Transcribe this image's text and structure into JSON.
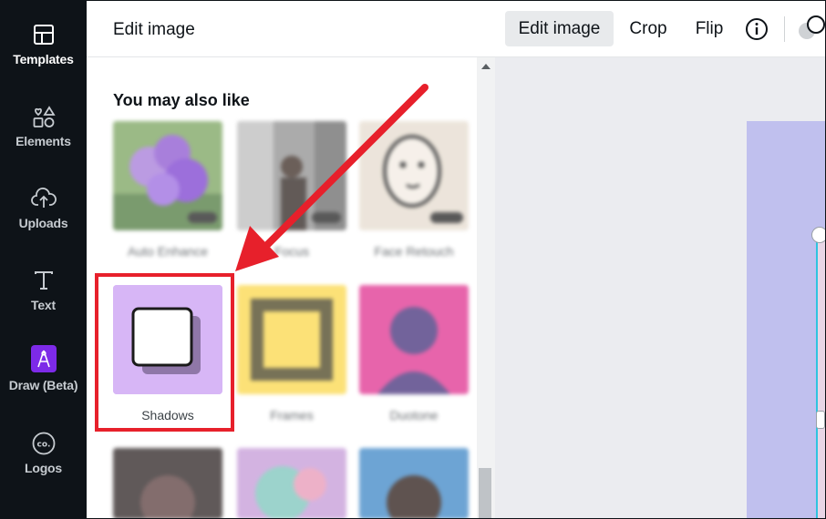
{
  "rail": {
    "items": [
      {
        "label": "Templates",
        "icon": "templates-icon",
        "active": true
      },
      {
        "label": "Elements",
        "icon": "elements-icon"
      },
      {
        "label": "Uploads",
        "icon": "uploads-icon"
      },
      {
        "label": "Text",
        "icon": "text-icon"
      },
      {
        "label": "Draw (Beta)",
        "icon": "draw-icon"
      },
      {
        "label": "Logos",
        "icon": "logos-icon"
      }
    ]
  },
  "panel": {
    "title": "Edit image",
    "section_title": "You may also like",
    "effects": [
      {
        "label": "Auto Enhance",
        "badge": "BETA"
      },
      {
        "label": "Focus",
        "badge": "BETA"
      },
      {
        "label": "Face Retouch",
        "badge": "BETA"
      },
      {
        "label": "Shadows"
      },
      {
        "label": "Frames"
      },
      {
        "label": "Duotone"
      }
    ]
  },
  "toolbar": {
    "edit_image": "Edit image",
    "crop": "Crop",
    "flip": "Flip",
    "info_icon": "info-icon",
    "transparency_icon": "transparency-icon"
  },
  "colors": {
    "rail_bg": "#0e1318",
    "highlight": "#e7202b",
    "shadows_tile": "#d7b6f6",
    "frames_tile": "#fbd84a",
    "duotone_tile": "#e0318f",
    "canvas_page": "#c0c0ee"
  }
}
